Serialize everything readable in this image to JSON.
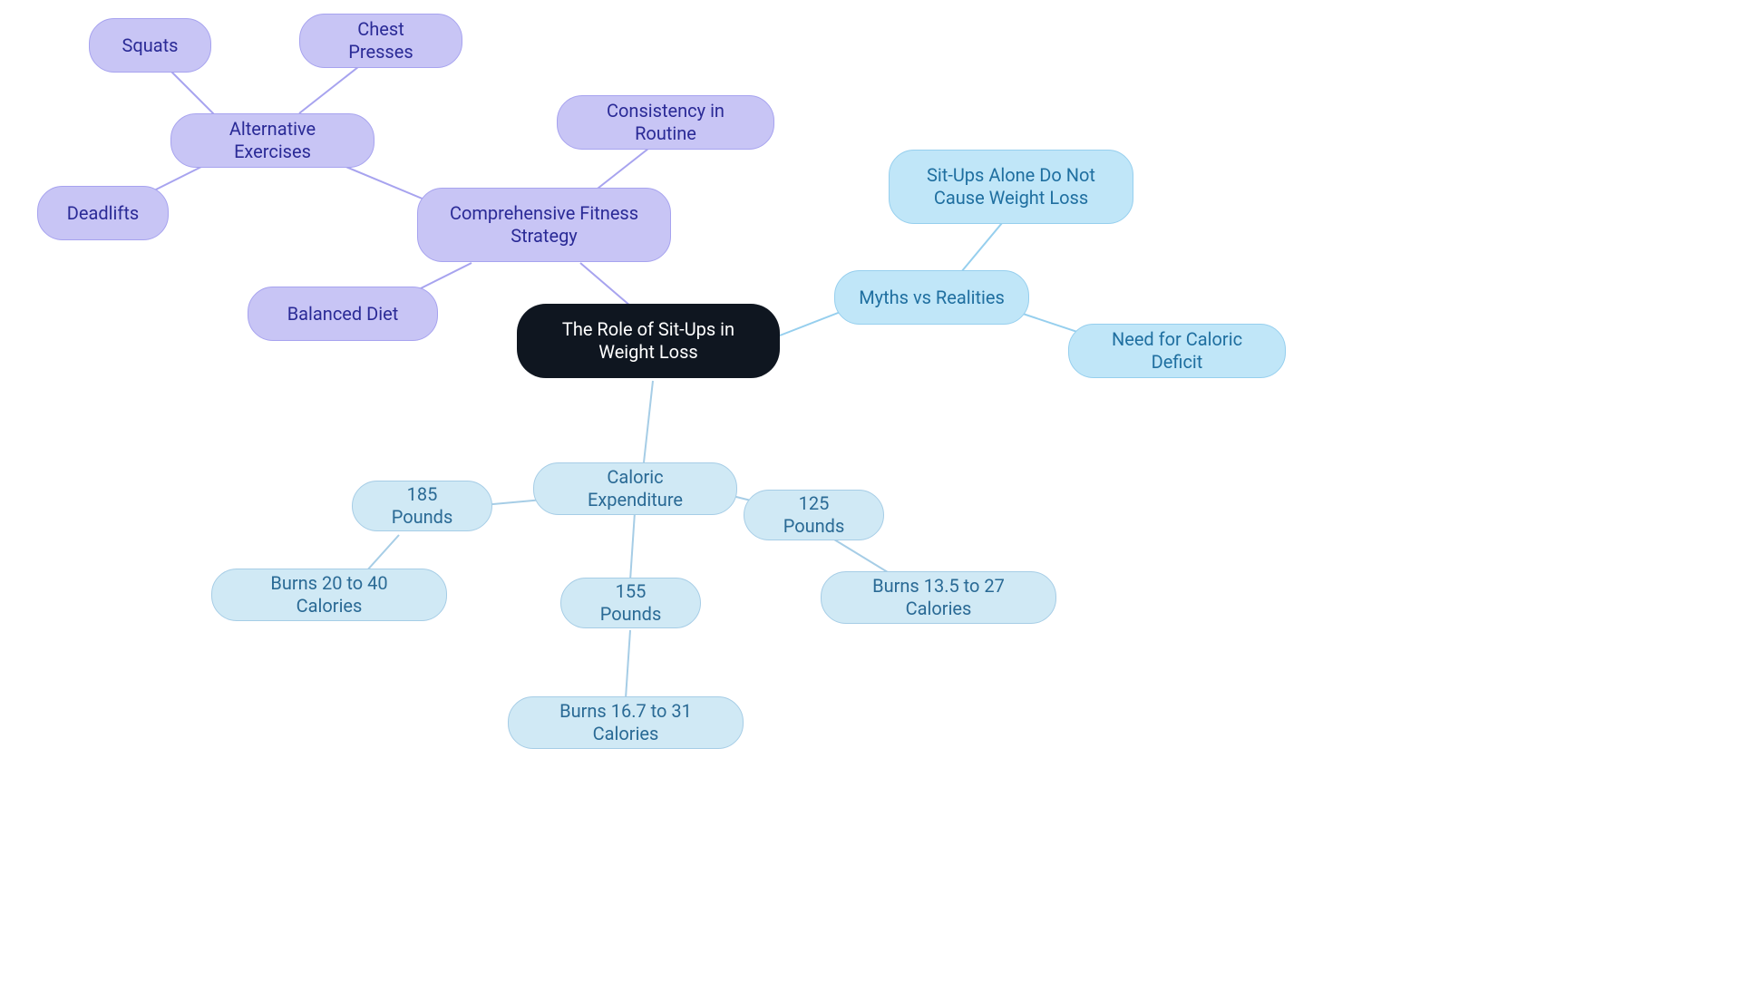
{
  "root": {
    "label": "The Role of Sit-Ups in Weight Loss"
  },
  "strategy": {
    "label": "Comprehensive Fitness Strategy",
    "consistency": "Consistency in Routine",
    "diet": "Balanced Diet",
    "alt": {
      "label": "Alternative Exercises",
      "squats": "Squats",
      "chest": "Chest Presses",
      "deadlifts": "Deadlifts"
    }
  },
  "myths": {
    "label": "Myths vs Realities",
    "situps": "Sit-Ups Alone Do Not Cause Weight Loss",
    "deficit": "Need for Caloric Deficit"
  },
  "caloric": {
    "label": "Caloric Expenditure",
    "w125": {
      "label": "125 Pounds",
      "burn": "Burns 13.5 to 27 Calories"
    },
    "w155": {
      "label": "155 Pounds",
      "burn": "Burns 16.7 to 31 Calories"
    },
    "w185": {
      "label": "185 Pounds",
      "burn": "Burns 20 to 40 Calories"
    }
  },
  "colors": {
    "root_bg": "#0f1620",
    "purple_fill": "#c8c5f5",
    "purple_text": "#2a2a96",
    "blue_fill": "#c0e6f8",
    "blue_text": "#1f6fa0",
    "bluepale_fill": "#d0e9f5",
    "bluepale_text": "#2a6a95"
  }
}
